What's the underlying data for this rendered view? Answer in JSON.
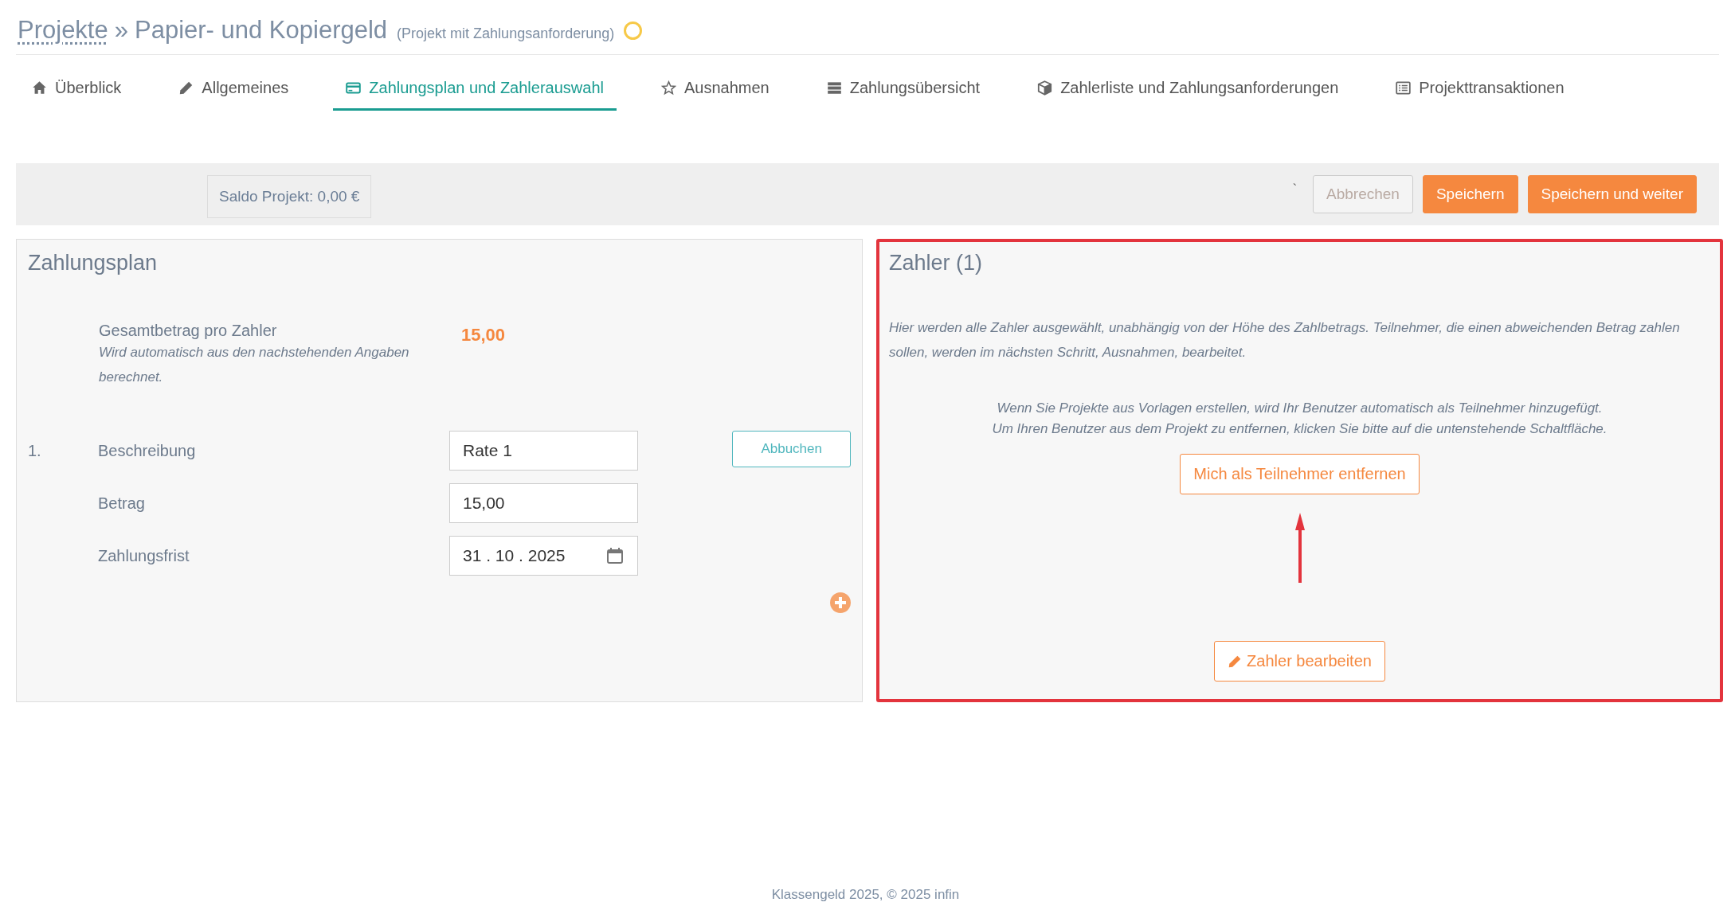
{
  "header": {
    "breadcrumb_link": "Projekte",
    "separator": "»",
    "title": "Papier- und Kopiergeld",
    "subtitle": "(Projekt mit Zahlungsanforderung)"
  },
  "tabs": [
    {
      "label": "Überblick",
      "selected": false
    },
    {
      "label": "Allgemeines",
      "selected": false
    },
    {
      "label": "Zahlungsplan und Zahlerauswahl",
      "selected": true
    },
    {
      "label": "Ausnahmen",
      "selected": false
    },
    {
      "label": "Zahlungsübersicht",
      "selected": false
    },
    {
      "label": "Zahlerliste und Zahlungsanforderungen",
      "selected": false
    },
    {
      "label": "Projekttransaktionen",
      "selected": false
    }
  ],
  "toolbar": {
    "saldo": "Saldo Projekt: 0,00 €",
    "mark": "`",
    "buttons": [
      {
        "label": "Abbrechen",
        "kind": "outline",
        "disabled": true
      },
      {
        "label": "Speichern",
        "kind": "primary",
        "disabled": false
      },
      {
        "label": "Speichern und weiter",
        "kind": "primary",
        "disabled": false
      }
    ]
  },
  "payment_plan": {
    "title": "Zahlungsplan",
    "total_label": "Gesamtbetrag pro Zahler",
    "total_hint": "Wird automatisch aus den nachstehenden Angaben berechnet.",
    "total_value": "15,00",
    "installments": [
      {
        "number": "1.",
        "description_label": "Beschreibung",
        "description": "Rate 1",
        "amount_label": "Betrag",
        "amount": "15,00",
        "due_label": "Zahlungsfrist",
        "due": "31 . 10 . 2025",
        "button": "Abbuchen"
      }
    ]
  },
  "payers": {
    "title": "Zahler (1)",
    "highlighted": true,
    "info": "Hier werden alle Zahler ausgewählt, unabhängig von der Höhe des Zahlbetrags. Teilnehmer, die einen abweichenden Betrag zahlen sollen, werden im nächsten Schritt, Ausnahmen, bearbeitet.",
    "note_lines": [
      "Wenn Sie Projekte aus Vorlagen erstellen, wird Ihr Benutzer automatisch als Teilnehmer hinzugefügt.",
      "Um Ihren Benutzer aus dem Projekt zu entfernen, klicken Sie bitte auf die untenstehende Schaltfläche."
    ],
    "remove_button": "Mich als Teilnehmer entfernen",
    "edit_button": "Zahler bearbeiten"
  },
  "footer": "Klassengeld 2025, © 2025 infin"
}
